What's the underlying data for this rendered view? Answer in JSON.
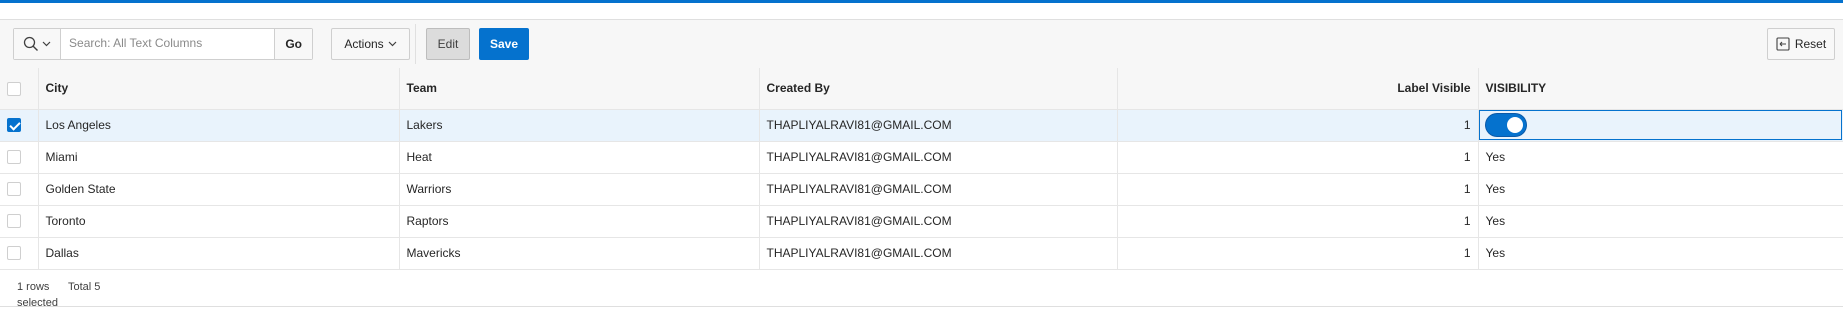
{
  "toolbar": {
    "search_placeholder": "Search: All Text Columns",
    "go_label": "Go",
    "actions_label": "Actions",
    "edit_label": "Edit",
    "save_label": "Save",
    "reset_label": "Reset"
  },
  "grid": {
    "columns": [
      "City",
      "Team",
      "Created By",
      "Label Visible",
      "VISIBILITY"
    ],
    "rows": [
      {
        "city": "Los Angeles",
        "team": "Lakers",
        "created_by": "THAPLIYALRAVI81@GMAIL.COM",
        "label_visible": "1",
        "visibility": "",
        "selected": true
      },
      {
        "city": "Miami",
        "team": "Heat",
        "created_by": "THAPLIYALRAVI81@GMAIL.COM",
        "label_visible": "1",
        "visibility": "Yes",
        "selected": false
      },
      {
        "city": "Golden State",
        "team": "Warriors",
        "created_by": "THAPLIYALRAVI81@GMAIL.COM",
        "label_visible": "1",
        "visibility": "Yes",
        "selected": false
      },
      {
        "city": "Toronto",
        "team": "Raptors",
        "created_by": "THAPLIYALRAVI81@GMAIL.COM",
        "label_visible": "1",
        "visibility": "Yes",
        "selected": false
      },
      {
        "city": "Dallas",
        "team": "Mavericks",
        "created_by": "THAPLIYALRAVI81@GMAIL.COM",
        "label_visible": "1",
        "visibility": "Yes",
        "selected": false
      }
    ]
  },
  "footer": {
    "rows_selected": "1 rows selected",
    "total": "Total 5"
  },
  "icons": [
    "search-icon",
    "chevron-down-icon",
    "reset-icon",
    "checkmark-icon"
  ],
  "colors": {
    "accent": "#0572ce",
    "selected_row": "#e9f3fc"
  }
}
